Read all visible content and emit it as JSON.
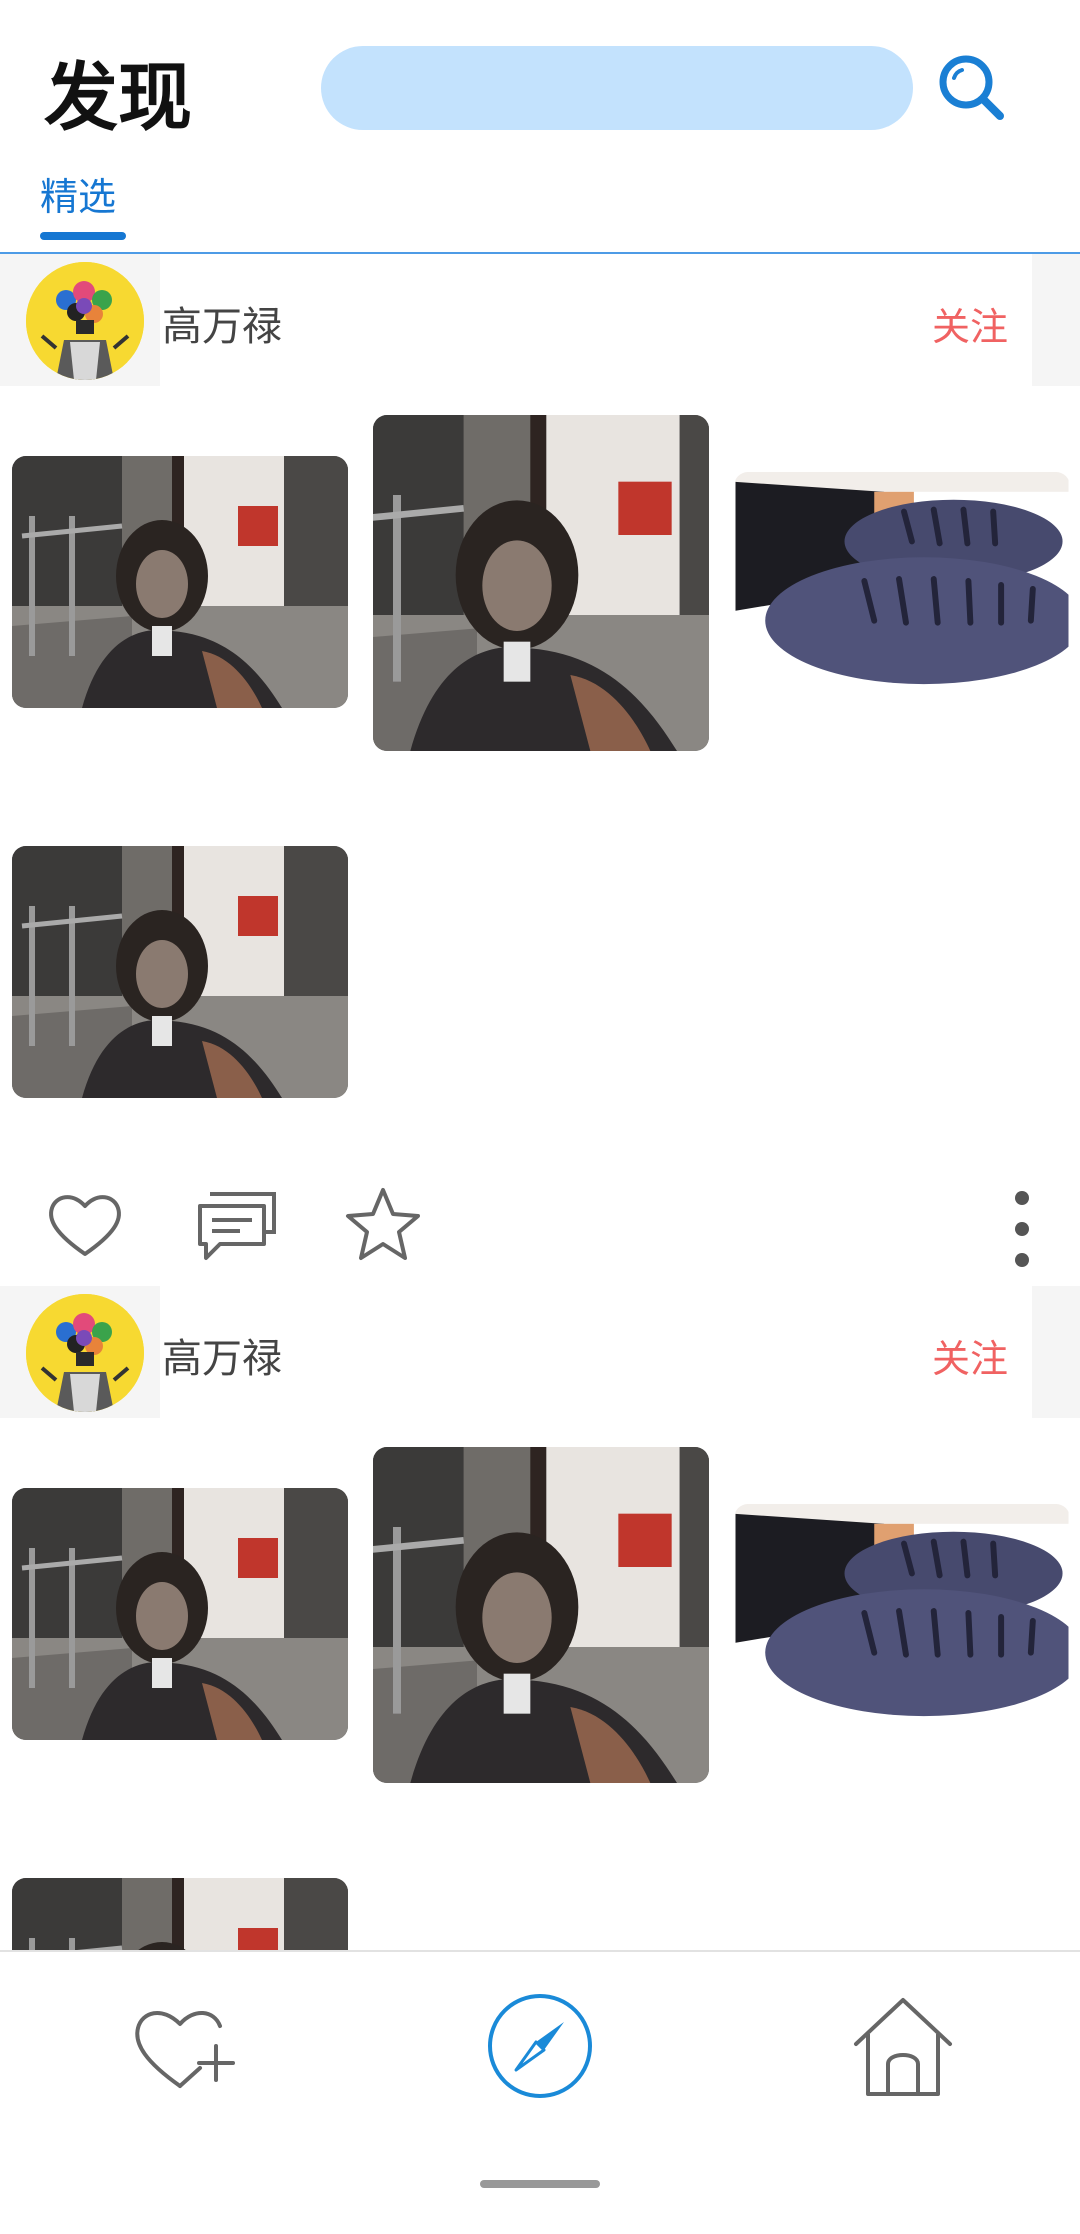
{
  "header": {
    "title": "发现",
    "search": {
      "placeholder": "",
      "icon": "search-icon"
    },
    "tabs": [
      {
        "label": "精选",
        "active": true
      }
    ]
  },
  "feed": {
    "posts": [
      {
        "author": "高万禄",
        "follow_label": "关注",
        "photos": [
          "blurry-person-photo",
          "blurry-person-photo",
          "shoes-photo",
          "blurry-person-photo"
        ],
        "actions": [
          "heart-icon",
          "comment-icon",
          "star-icon",
          "more-icon"
        ]
      },
      {
        "author": "高万禄",
        "follow_label": "关注",
        "photos": [
          "blurry-person-photo",
          "blurry-person-photo",
          "shoes-photo",
          "blurry-person-photo"
        ]
      }
    ]
  },
  "bottom_nav": {
    "items": [
      {
        "icon": "heart-plus-icon"
      },
      {
        "icon": "compass-icon",
        "active": true
      },
      {
        "icon": "home-icon"
      }
    ]
  },
  "colors": {
    "accent": "#1677d2",
    "search_bg": "#c3e2fd",
    "follow": "#f06262",
    "avatar_bg": "#f7d931"
  }
}
